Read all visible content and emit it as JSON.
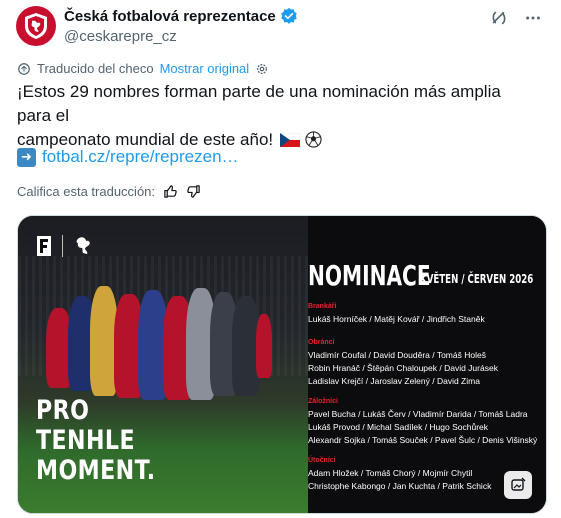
{
  "account": {
    "display_name": "Česká fotbalová reprezentace",
    "handle": "@ceskarepre_cz"
  },
  "icons": {
    "avatar": "lion-crest-icon",
    "verified": "verified-badge-icon",
    "grok": "grok-icon",
    "more": "more-icon",
    "translate": "translate-icon",
    "settings": "settings-gear-icon",
    "link_arrow": "right-arrow-icon",
    "thumbs_up": "thumbs-up-icon",
    "thumbs_down": "thumbs-down-icon",
    "alt_edit": "edit-image-icon"
  },
  "translation": {
    "label": "Traducido del checo",
    "show_original": "Mostrar original"
  },
  "tweet": {
    "line1": "¡Estos 29 nombres forman parte de una nominación más amplia para el",
    "line2": "campeonato mundial de este año!",
    "link": "fotbal.cz/repre/reprezen…"
  },
  "rating": {
    "label": "Califica esta traducción:"
  },
  "media": {
    "slogan": [
      "PRO",
      "TENHLE",
      "MOMENT."
    ],
    "title": "NOMINACE",
    "date": "KVĚTEN / ČERVEN 2026",
    "groups": [
      {
        "label": "Brankáři",
        "lines": [
          "Lukáš Horníček / Matěj Kovář / Jindřich Staněk"
        ]
      },
      {
        "label": "Obránci",
        "lines": [
          "Vladimír Coufal / David Douděra / Tomáš Holeš",
          "Robin Hranáč / Štěpán Chaloupek / David Jurásek",
          "Ladislav Krejčí / Jaroslav Zelený / David Zima"
        ]
      },
      {
        "label": "Záložníci",
        "lines": [
          "Pavel Bucha / Lukáš Červ / Vladimír Darida / Tomáš Ladra",
          "Lukáš Provod / Michal Sadílek / Hugo Sochůrek",
          "Alexandr Sojka / Tomáš Souček / Pavel Šulc / Denis Višinský"
        ]
      },
      {
        "label": "Útočníci",
        "lines": [
          "Adam Hložek / Tomáš Chorý / Mojmír Chytil",
          "Christophe Kabongo / Jan Kuchta / Patrik Schick"
        ]
      }
    ]
  },
  "colors": {
    "link": "#1d9bf0",
    "secondary_text": "#536471",
    "brand_red": "#c8102e",
    "accent_red": "#e3242b"
  }
}
